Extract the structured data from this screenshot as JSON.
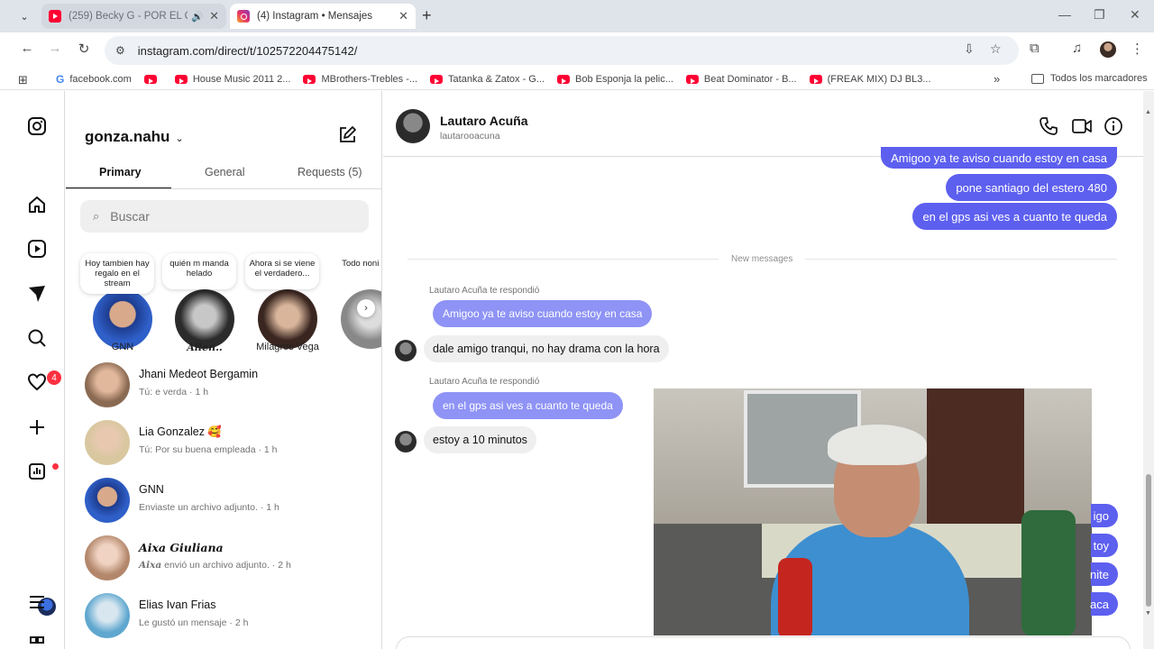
{
  "browser": {
    "tabs": [
      {
        "title": "(259) Becky G - POR EL CO...",
        "favicon": "youtube-icon",
        "active": false
      },
      {
        "title": "(4) Instagram • Mensajes",
        "favicon": "instagram-icon",
        "active": true
      }
    ],
    "url": "instagram.com/direct/t/102572204475142/",
    "bookmarks": [
      {
        "label": "facebook.com",
        "icon": "google-icon"
      },
      {
        "label": "",
        "icon": "youtube-icon"
      },
      {
        "label": "House Music 2011 2...",
        "icon": "youtube-icon"
      },
      {
        "label": "MBrothers-Trebles -...",
        "icon": "youtube-icon"
      },
      {
        "label": "Tatanka & Zatox - G...",
        "icon": "youtube-icon"
      },
      {
        "label": "Bob Esponja la pelic...",
        "icon": "youtube-icon"
      },
      {
        "label": "Beat Dominator - B...",
        "icon": "youtube-icon"
      },
      {
        "label": "(FREAK MIX) DJ BL3...",
        "icon": "youtube-icon"
      }
    ],
    "all_bookmarks": "Todos los marcadores"
  },
  "rail": {
    "notification_count": "4"
  },
  "inbox": {
    "username": "gonza.nahu",
    "tabs": {
      "primary": "Primary",
      "general": "General",
      "requests": "Requests (5)"
    },
    "search_placeholder": "Buscar",
    "notes": [
      {
        "text": "Hoy tambien hay regalo en el stream",
        "name": "GNN"
      },
      {
        "text": "quién m manda helado",
        "name": "Allen.."
      },
      {
        "text": "Ahora si se viene el verdadero...",
        "name": "Milagros Vega"
      },
      {
        "text": "Todo noni m",
        "name": ""
      }
    ],
    "conversations": [
      {
        "name": "Jhani Medeot Bergamin",
        "preview": "Tú: e verda · 1 h"
      },
      {
        "name": "Lia Gonzalez 🥰",
        "preview": "Tú: Por su buena empleada · 1 h"
      },
      {
        "name": "GNN",
        "preview": "Enviaste un archivo adjunto. · 1 h"
      },
      {
        "name": "Aixa Giuliana",
        "preview_prefix": "Aixa",
        "preview": " envió un archivo adjunto. · 2 h"
      },
      {
        "name": "Elias Ivan Frias",
        "preview": "Le gustó un mensaje · 2 h"
      }
    ]
  },
  "chat": {
    "contact_name": "Lautaro Acuña",
    "contact_handle": "lautarooacuna",
    "outgoing_top": [
      "Amigoo ya te aviso cuando estoy en casa",
      "pone santiago del estero 480",
      "en el gps asi ves a cuanto te queda"
    ],
    "new_messages_label": "New messages",
    "threads": [
      {
        "replied_label": "Lautaro Acuña te respondió",
        "quoted": "Amigoo ya te aviso cuando estoy en casa",
        "reply": "dale amigo tranqui, no hay drama con la hora"
      },
      {
        "replied_label": "Lautaro Acuña te respondió",
        "quoted": "en el gps asi ves a cuanto te queda",
        "reply": "estoy a 10 minutos"
      }
    ],
    "outgoing_bottom_fragments": [
      "igo",
      "toy",
      "nite",
      "aca"
    ],
    "accent_color": "#5d5fef"
  }
}
